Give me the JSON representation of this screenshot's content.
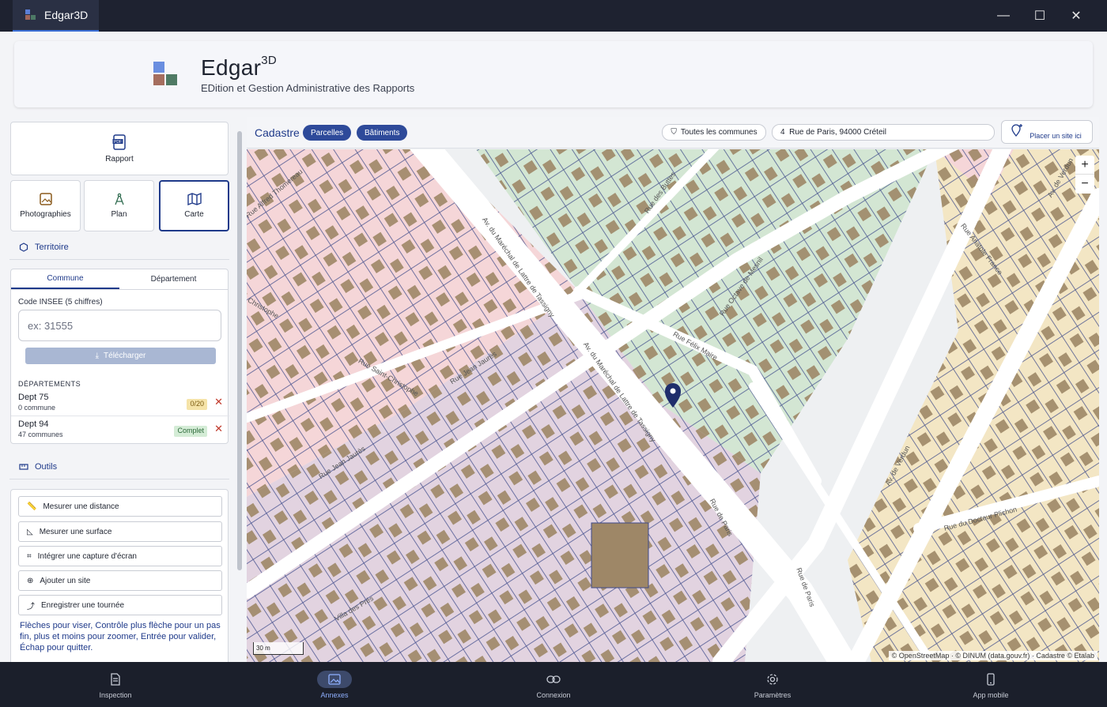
{
  "window": {
    "title": "Edgar3D",
    "minimize": "—",
    "maximize": "☐",
    "close": "✕"
  },
  "header": {
    "name": "Edgar",
    "name_sup": "3D",
    "tagline": "EDition et Gestion Administrative des Rapports"
  },
  "sidebar": {
    "rapport_label": "Rapport",
    "photographies_label": "Photographies",
    "plan_label": "Plan",
    "carte_label": "Carte",
    "territoire_title": "Territoire",
    "tabs": [
      "Commune",
      "Département"
    ],
    "code_label": "Code INSEE (5 chiffres)",
    "code_placeholder": "ex: 31555",
    "download_label": "Télécharger",
    "departements_title": "DÉPARTEMENTS",
    "departements": [
      {
        "name": "Dept 75",
        "count": "0 commune",
        "badge": "0/20",
        "badge_color": "#f5e3a8"
      },
      {
        "name": "Dept 94",
        "count": "47 communes",
        "badge": "Complet",
        "badge_color": "#d4ecd6"
      }
    ],
    "outils_title": "Outils",
    "tools": [
      "Mesurer une distance",
      "Mesurer une surface",
      "Intégrer une capture d'écran",
      "Ajouter un site",
      "Enregistrer une tournée"
    ],
    "help_text": "Flèches pour viser, Contrôle plus flèche pour un pas fin, plus et moins pour zoomer, Entrée pour valider, Échap pour quitter."
  },
  "map_panel": {
    "title": "Cadastre",
    "layers": [
      "Parcelles",
      "Bâtiments"
    ],
    "filter_label": "Toutes les communes",
    "address_value": "4  Rue de Paris, 94000 Créteil",
    "place_label": "Placer un site ici",
    "zoom_in": "+",
    "zoom_out": "−",
    "scale_label": "30 m",
    "attribution": "© OpenStreetMap · © DINUM (data.gouv.fr) · Cadastre © Etalab",
    "streets": [
      "Av. du Maréchal de Lattre de Tassigny",
      "Av. du Maréchal de Lattre de Tassigny",
      "Rue Félix Maire",
      "Rue Octave de Mesnil",
      "Rue des Buttes",
      "Rue Anatole France",
      "Av. de Verdun",
      "Av. de Verdun",
      "Rue Jean Jaurès",
      "Rue Jean Jaurès",
      "Rue Saint-Christophe",
      "Rue de Paris",
      "Rue de Paris",
      "Rue du Docteur Plichon",
      "Villa des Prés",
      "Christophe",
      "Rue Alfred Thomereau"
    ]
  },
  "bottom_nav": [
    "Inspection",
    "Annexes",
    "Connexion",
    "Paramètres",
    "App mobile"
  ],
  "colors": {
    "accent": "#1f3a8a",
    "pill": "#2e4a9a",
    "zone_pink": "#f5d6d8",
    "zone_green": "#d3e6d3",
    "zone_mauve": "#e2d3e0",
    "zone_yellow": "#f3e6c4",
    "building": "#9e8767"
  }
}
